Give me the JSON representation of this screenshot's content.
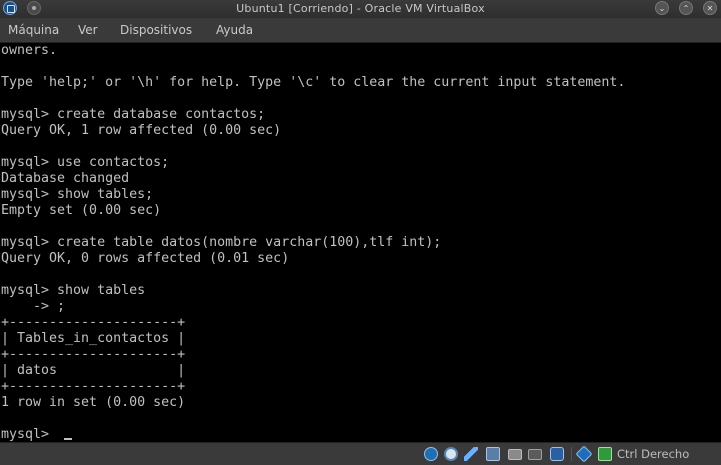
{
  "window": {
    "title": "Ubuntu1 [Corriendo] - Oracle VM VirtualBox",
    "controls": {
      "minimize": "⌄",
      "maximize": "⌃",
      "close": "✕"
    }
  },
  "menu": [
    "Máquina",
    "Ver",
    "Dispositivos",
    "Ayuda"
  ],
  "terminal": {
    "lines": [
      "owners.",
      "",
      "Type 'help;' or '\\h' for help. Type '\\c' to clear the current input statement.",
      "",
      "mysql> create database contactos;",
      "Query OK, 1 row affected (0.00 sec)",
      "",
      "mysql> use contactos;",
      "Database changed",
      "mysql> show tables;",
      "Empty set (0.00 sec)",
      "",
      "mysql> create table datos(nombre varchar(100),tlf int);",
      "Query OK, 0 rows affected (0.01 sec)",
      "",
      "mysql> show tables",
      "    -> ;",
      "+---------------------+",
      "| Tables_in_contactos |",
      "+---------------------+",
      "| datos               |",
      "+---------------------+",
      "1 row in set (0.00 sec)",
      "",
      "mysql> "
    ]
  },
  "statusbar": {
    "icons": [
      "hard-disk-icon",
      "optical-drive-icon",
      "pen-icon",
      "network-icon",
      "shared-folder-icon",
      "display-icon",
      "usb-icon",
      "cpu-icon",
      "host-key-arrow-icon"
    ],
    "host_key": "Ctrl Derecho"
  }
}
